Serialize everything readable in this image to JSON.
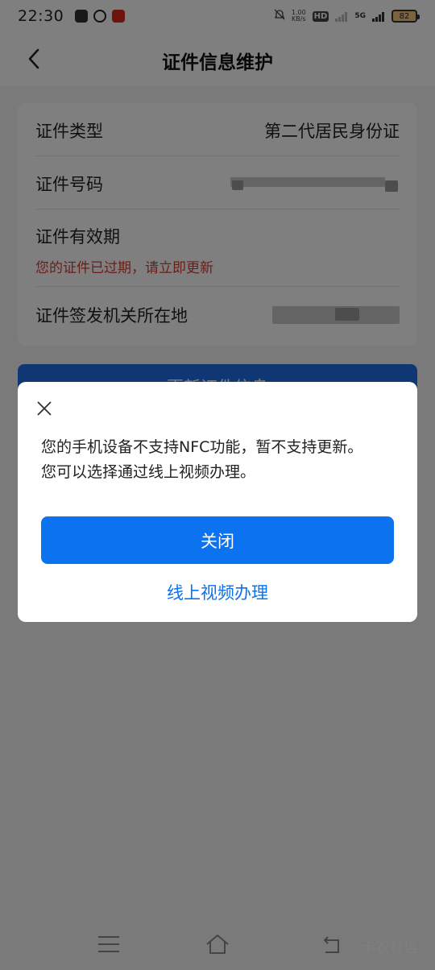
{
  "status_bar": {
    "time": "22:30",
    "speed_value": "1.00",
    "speed_unit": "KB/s",
    "hd_label": "HD",
    "network": "5G",
    "battery": "82"
  },
  "header": {
    "title": "证件信息维护"
  },
  "card": {
    "rows": [
      {
        "label": "证件类型",
        "value": "第二代居民身份证"
      },
      {
        "label": "证件号码",
        "value": ""
      },
      {
        "label": "证件有效期",
        "warning": "您的证件已过期，请立即更新"
      },
      {
        "label": "证件签发机关所在地",
        "value": ""
      }
    ]
  },
  "update_button": {
    "label": "更新证件信息"
  },
  "dialog": {
    "message_line1": "您的手机设备不支持NFC功能，暂不支持更新。",
    "message_line2": "您可以选择通过线上视频办理。",
    "primary_label": "关闭",
    "secondary_label": "线上视频办理"
  },
  "nav": {
    "watermark": "卡农社区"
  },
  "colors": {
    "primary": "#0b72f0",
    "warning": "#d93b30",
    "overlay": "rgba(0,0,0,0.5)"
  },
  "icons": [
    "back-arrow-icon",
    "close-icon",
    "menu-icon",
    "home-icon",
    "return-icon",
    "bell-muted-icon",
    "battery-icon"
  ]
}
